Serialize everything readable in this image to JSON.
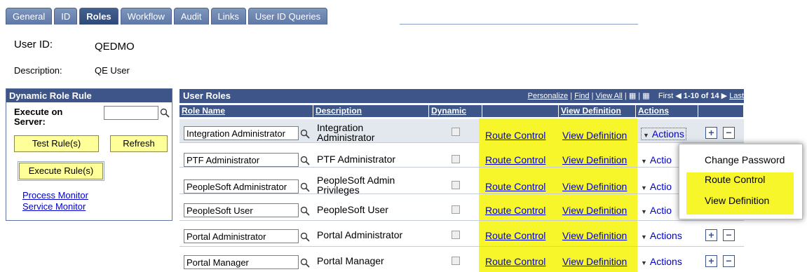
{
  "tabs": [
    {
      "label": "General"
    },
    {
      "label": "ID"
    },
    {
      "label": "Roles"
    },
    {
      "label": "Workflow"
    },
    {
      "label": "Audit"
    },
    {
      "label": "Links"
    },
    {
      "label": "User ID Queries"
    }
  ],
  "header": {
    "user_id_label": "User ID:",
    "user_id_value": "QEDMO",
    "description_label": "Description:",
    "description_value": "QE User"
  },
  "dynamic_role_rule": {
    "title": "Dynamic Role Rule",
    "execute_on_server_label": "Execute on Server:",
    "server_value": "",
    "test_rules_button": "Test Rule(s)",
    "refresh_button": "Refresh",
    "execute_rules_button": "Execute Rule(s)",
    "process_monitor_link": "Process Monitor",
    "service_monitor_link": "Service Monitor"
  },
  "user_roles": {
    "title": "User Roles",
    "personalize": "Personalize",
    "find": "Find",
    "view_all": "View All",
    "first": "First",
    "range": "1-10 of 14",
    "last": "Last",
    "columns": [
      "Role Name",
      "Description",
      "Dynamic",
      "",
      "View Definition",
      "Actions"
    ],
    "rows": [
      {
        "role": "Integration Administrator",
        "desc_line1": "Integration",
        "desc_line2": "Administrator",
        "route": "Route Control",
        "view": "View Definition",
        "actions": "Actions"
      },
      {
        "role": "PTF Administrator",
        "desc_line1": "PTF Administrator",
        "desc_line2": "",
        "route": "Route Control",
        "view": "View Definition",
        "actions": "Actio"
      },
      {
        "role": "PeopleSoft Administrator",
        "desc_line1": "PeopleSoft Admin",
        "desc_line2": "Privileges",
        "route": "Route Control",
        "view": "View Definition",
        "actions": "Actio"
      },
      {
        "role": "PeopleSoft User",
        "desc_line1": "PeopleSoft User",
        "desc_line2": "",
        "route": "Route Control",
        "view": "View Definition",
        "actions": "Actio"
      },
      {
        "role": "Portal Administrator",
        "desc_line1": "Portal Administrator",
        "desc_line2": "",
        "route": "Route Control",
        "view": "View Definition",
        "actions": "Actions"
      },
      {
        "role": "Portal Manager",
        "desc_line1": "Portal Manager",
        "desc_line2": "",
        "route": "Route Control",
        "view": "View Definition",
        "actions": "Actions"
      }
    ]
  },
  "popup_menu": {
    "items": [
      "Change Password",
      "Route Control",
      "View Definition"
    ]
  },
  "colors": {
    "header_blue": "#3d5588",
    "highlight_yellow": "#f6f62a",
    "button_yellow": "#ffff99",
    "link_blue": "#0000cc"
  }
}
